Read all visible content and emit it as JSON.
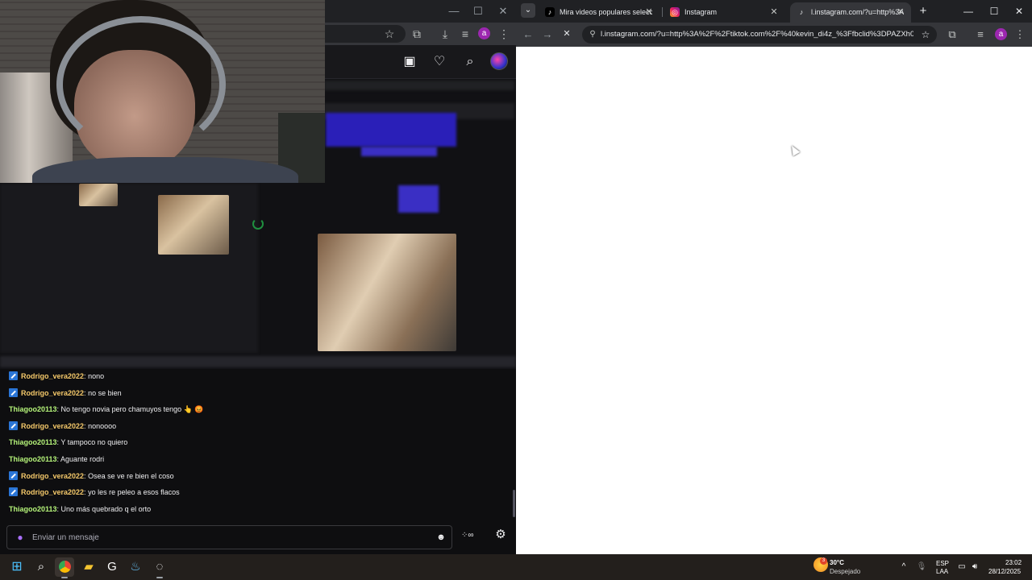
{
  "right_browser": {
    "tabs": [
      {
        "title": "Mira videos populares seleccio",
        "favicon": "tiktok-icon",
        "active": false
      },
      {
        "title": "Instagram",
        "favicon": "instagram-icon",
        "active": false
      },
      {
        "title": "l.instagram.com/?u=http%3A%",
        "favicon": "tiktok-icon",
        "active": true
      }
    ],
    "url": "l.instagram.com/?u=http%3A%2F%2Ftiktok.com%2F%40kevin_di4z_%3Ffbclid%3DPAZXh0b..."
  },
  "left_browser": {
    "avatar_initial": "a"
  },
  "twitch_header": {
    "icons": [
      "video-icon",
      "heart-icon",
      "search-icon"
    ]
  },
  "chat": {
    "messages": [
      {
        "user": "Rodrigo_vera2022",
        "badge": true,
        "text": "nono"
      },
      {
        "user": "Rodrigo_vera2022",
        "badge": true,
        "text": "no se bien"
      },
      {
        "user": "Thiagoo20113",
        "badge": false,
        "text": "No tengo novia pero chamuyos tengo 👆 😡"
      },
      {
        "user": "Rodrigo_vera2022",
        "badge": true,
        "text": "nonoooo"
      },
      {
        "user": "Thiagoo20113",
        "badge": false,
        "text": "Y tampoco no quiero"
      },
      {
        "user": "Thiagoo20113",
        "badge": false,
        "text": "Aguante rodri"
      },
      {
        "user": "Rodrigo_vera2022",
        "badge": true,
        "text": "Osea se ve re bien el coso"
      },
      {
        "user": "Rodrigo_vera2022",
        "badge": true,
        "text": "yo les re peleo a esos flacos"
      },
      {
        "user": "Thiagoo20113",
        "badge": false,
        "text": "Uno más quebrado q el orto"
      }
    ],
    "input_placeholder": "Enviar un mensaje",
    "points_label": "∞"
  },
  "taskbar": {
    "weather_temp": "30°C",
    "weather_desc": "Despejado",
    "weather_badge": "3",
    "lang_top": "ESP",
    "lang_bottom": "LAA",
    "time": "23:02",
    "date": "28/12/2025"
  },
  "colors": {
    "twitch_bg": "#0e0e10",
    "chrome_dark": "#202124",
    "chrome_toolbar": "#35363a",
    "username_rodrigo": "#f5c96a",
    "username_thiago": "#b6f57a",
    "badge_blue": "#2a75d6",
    "twitch_purple": "#a970ff"
  }
}
